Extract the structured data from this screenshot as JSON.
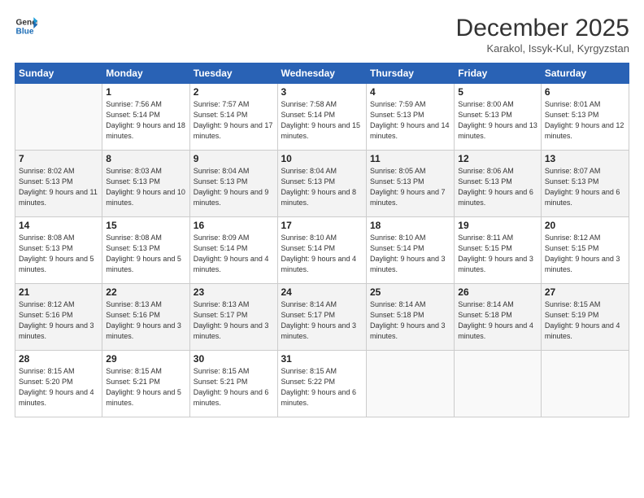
{
  "logo": {
    "line1": "General",
    "line2": "Blue"
  },
  "title": "December 2025",
  "location": "Karakol, Issyk-Kul, Kyrgyzstan",
  "header_row": [
    "Sunday",
    "Monday",
    "Tuesday",
    "Wednesday",
    "Thursday",
    "Friday",
    "Saturday"
  ],
  "weeks": [
    [
      {
        "day": "",
        "sunrise": "",
        "sunset": "",
        "daylight": ""
      },
      {
        "day": "1",
        "sunrise": "Sunrise: 7:56 AM",
        "sunset": "Sunset: 5:14 PM",
        "daylight": "Daylight: 9 hours and 18 minutes."
      },
      {
        "day": "2",
        "sunrise": "Sunrise: 7:57 AM",
        "sunset": "Sunset: 5:14 PM",
        "daylight": "Daylight: 9 hours and 17 minutes."
      },
      {
        "day": "3",
        "sunrise": "Sunrise: 7:58 AM",
        "sunset": "Sunset: 5:14 PM",
        "daylight": "Daylight: 9 hours and 15 minutes."
      },
      {
        "day": "4",
        "sunrise": "Sunrise: 7:59 AM",
        "sunset": "Sunset: 5:13 PM",
        "daylight": "Daylight: 9 hours and 14 minutes."
      },
      {
        "day": "5",
        "sunrise": "Sunrise: 8:00 AM",
        "sunset": "Sunset: 5:13 PM",
        "daylight": "Daylight: 9 hours and 13 minutes."
      },
      {
        "day": "6",
        "sunrise": "Sunrise: 8:01 AM",
        "sunset": "Sunset: 5:13 PM",
        "daylight": "Daylight: 9 hours and 12 minutes."
      }
    ],
    [
      {
        "day": "7",
        "sunrise": "Sunrise: 8:02 AM",
        "sunset": "Sunset: 5:13 PM",
        "daylight": "Daylight: 9 hours and 11 minutes."
      },
      {
        "day": "8",
        "sunrise": "Sunrise: 8:03 AM",
        "sunset": "Sunset: 5:13 PM",
        "daylight": "Daylight: 9 hours and 10 minutes."
      },
      {
        "day": "9",
        "sunrise": "Sunrise: 8:04 AM",
        "sunset": "Sunset: 5:13 PM",
        "daylight": "Daylight: 9 hours and 9 minutes."
      },
      {
        "day": "10",
        "sunrise": "Sunrise: 8:04 AM",
        "sunset": "Sunset: 5:13 PM",
        "daylight": "Daylight: 9 hours and 8 minutes."
      },
      {
        "day": "11",
        "sunrise": "Sunrise: 8:05 AM",
        "sunset": "Sunset: 5:13 PM",
        "daylight": "Daylight: 9 hours and 7 minutes."
      },
      {
        "day": "12",
        "sunrise": "Sunrise: 8:06 AM",
        "sunset": "Sunset: 5:13 PM",
        "daylight": "Daylight: 9 hours and 6 minutes."
      },
      {
        "day": "13",
        "sunrise": "Sunrise: 8:07 AM",
        "sunset": "Sunset: 5:13 PM",
        "daylight": "Daylight: 9 hours and 6 minutes."
      }
    ],
    [
      {
        "day": "14",
        "sunrise": "Sunrise: 8:08 AM",
        "sunset": "Sunset: 5:13 PM",
        "daylight": "Daylight: 9 hours and 5 minutes."
      },
      {
        "day": "15",
        "sunrise": "Sunrise: 8:08 AM",
        "sunset": "Sunset: 5:13 PM",
        "daylight": "Daylight: 9 hours and 5 minutes."
      },
      {
        "day": "16",
        "sunrise": "Sunrise: 8:09 AM",
        "sunset": "Sunset: 5:14 PM",
        "daylight": "Daylight: 9 hours and 4 minutes."
      },
      {
        "day": "17",
        "sunrise": "Sunrise: 8:10 AM",
        "sunset": "Sunset: 5:14 PM",
        "daylight": "Daylight: 9 hours and 4 minutes."
      },
      {
        "day": "18",
        "sunrise": "Sunrise: 8:10 AM",
        "sunset": "Sunset: 5:14 PM",
        "daylight": "Daylight: 9 hours and 3 minutes."
      },
      {
        "day": "19",
        "sunrise": "Sunrise: 8:11 AM",
        "sunset": "Sunset: 5:15 PM",
        "daylight": "Daylight: 9 hours and 3 minutes."
      },
      {
        "day": "20",
        "sunrise": "Sunrise: 8:12 AM",
        "sunset": "Sunset: 5:15 PM",
        "daylight": "Daylight: 9 hours and 3 minutes."
      }
    ],
    [
      {
        "day": "21",
        "sunrise": "Sunrise: 8:12 AM",
        "sunset": "Sunset: 5:16 PM",
        "daylight": "Daylight: 9 hours and 3 minutes."
      },
      {
        "day": "22",
        "sunrise": "Sunrise: 8:13 AM",
        "sunset": "Sunset: 5:16 PM",
        "daylight": "Daylight: 9 hours and 3 minutes."
      },
      {
        "day": "23",
        "sunrise": "Sunrise: 8:13 AM",
        "sunset": "Sunset: 5:17 PM",
        "daylight": "Daylight: 9 hours and 3 minutes."
      },
      {
        "day": "24",
        "sunrise": "Sunrise: 8:14 AM",
        "sunset": "Sunset: 5:17 PM",
        "daylight": "Daylight: 9 hours and 3 minutes."
      },
      {
        "day": "25",
        "sunrise": "Sunrise: 8:14 AM",
        "sunset": "Sunset: 5:18 PM",
        "daylight": "Daylight: 9 hours and 3 minutes."
      },
      {
        "day": "26",
        "sunrise": "Sunrise: 8:14 AM",
        "sunset": "Sunset: 5:18 PM",
        "daylight": "Daylight: 9 hours and 4 minutes."
      },
      {
        "day": "27",
        "sunrise": "Sunrise: 8:15 AM",
        "sunset": "Sunset: 5:19 PM",
        "daylight": "Daylight: 9 hours and 4 minutes."
      }
    ],
    [
      {
        "day": "28",
        "sunrise": "Sunrise: 8:15 AM",
        "sunset": "Sunset: 5:20 PM",
        "daylight": "Daylight: 9 hours and 4 minutes."
      },
      {
        "day": "29",
        "sunrise": "Sunrise: 8:15 AM",
        "sunset": "Sunset: 5:21 PM",
        "daylight": "Daylight: 9 hours and 5 minutes."
      },
      {
        "day": "30",
        "sunrise": "Sunrise: 8:15 AM",
        "sunset": "Sunset: 5:21 PM",
        "daylight": "Daylight: 9 hours and 6 minutes."
      },
      {
        "day": "31",
        "sunrise": "Sunrise: 8:15 AM",
        "sunset": "Sunset: 5:22 PM",
        "daylight": "Daylight: 9 hours and 6 minutes."
      },
      {
        "day": "",
        "sunrise": "",
        "sunset": "",
        "daylight": ""
      },
      {
        "day": "",
        "sunrise": "",
        "sunset": "",
        "daylight": ""
      },
      {
        "day": "",
        "sunrise": "",
        "sunset": "",
        "daylight": ""
      }
    ]
  ]
}
